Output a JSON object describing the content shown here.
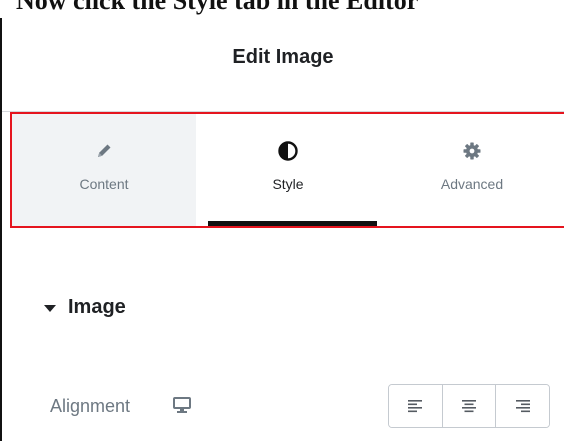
{
  "caption": {
    "text": "Now click the Style tab in the Editor"
  },
  "panel": {
    "title": "Edit Image"
  },
  "tabs": [
    {
      "label": "Content",
      "icon": "pencil-icon",
      "active": false
    },
    {
      "label": "Style",
      "icon": "half-circle-icon",
      "active": true
    },
    {
      "label": "Advanced",
      "icon": "gear-icon",
      "active": false
    }
  ],
  "section": {
    "title": "Image",
    "state": "expanded"
  },
  "alignment": {
    "label": "Alignment",
    "device_icon": "desktop-icon",
    "options": [
      "align-left",
      "align-center",
      "align-right"
    ]
  },
  "colors": {
    "highlight": "#e5141e",
    "active_underline": "#111111",
    "inactive_tab_bg": "#f1f3f5",
    "label_gray": "#6d7882"
  }
}
